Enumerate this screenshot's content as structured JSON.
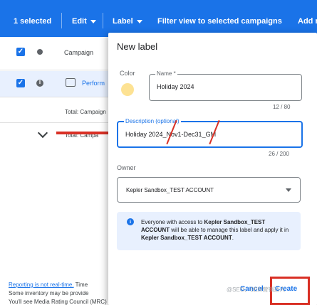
{
  "topbar": {
    "selected": "1 selected",
    "edit": "Edit",
    "label": "Label",
    "filter": "Filter view to selected campaigns",
    "add": "Add n"
  },
  "table": {
    "header_campaign": "Campaign",
    "row_name": "Perform",
    "total_campaign": "Total: Campaign",
    "total_campaign_2": "Total: Campa"
  },
  "footer": {
    "reporting_link": "Reporting is not real-time.",
    "reporting_rest": "Time",
    "inventory": "Some inventory may be provide",
    "mrc": "You'll see Media Rating Council (MRC) accreditation noted in the column header"
  },
  "dialog": {
    "title": "New label",
    "color_label": "Color",
    "swatch_color": "#fde293",
    "name_label": "Name *",
    "name_value": "Holiday 2024",
    "name_counter": "12 / 80",
    "description_label": "Description (optional)",
    "description_value": "Holiday 2024_Nov1-Dec31_GM",
    "description_counter": "26 / 200",
    "owner_label": "Owner",
    "owner_value": "Kepler Sandbox_TEST ACCOUNT",
    "info_pre": "Everyone with access to ",
    "info_bold1": "Kepler Sandbox_TEST ACCOUNT",
    "info_mid": " will be able to manage this label and apply it in ",
    "info_bold2": "Kepler Sandbox_TEST ACCOUNT",
    "info_end": ".",
    "cancel": "Cancel",
    "create": "Create"
  },
  "watermark": "@SEO、SEM营销达人",
  "colors": {
    "accent": "#1a73e8",
    "annotation_red": "#d93025"
  }
}
